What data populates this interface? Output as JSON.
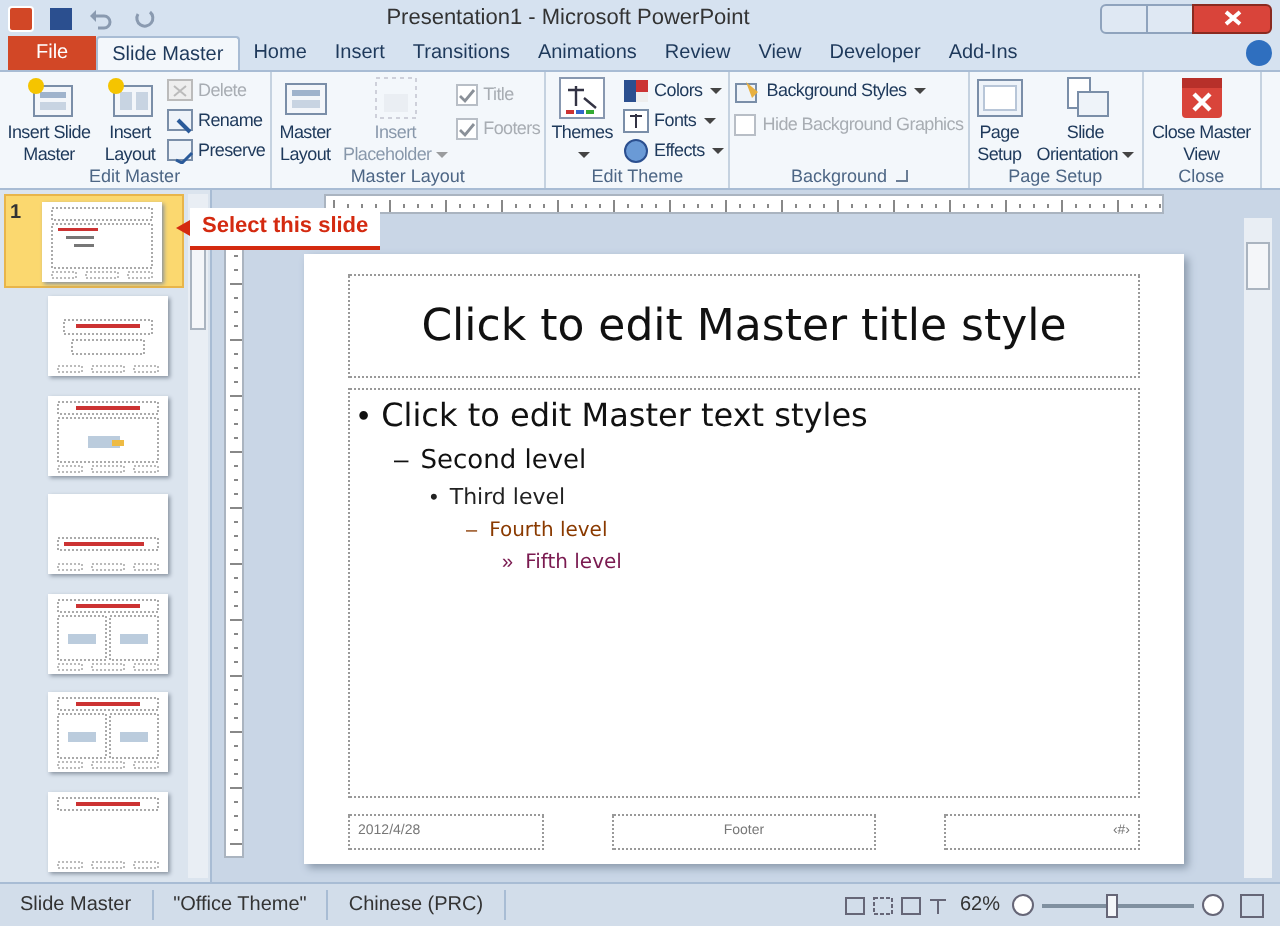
{
  "window": {
    "title": "Presentation1 - Microsoft PowerPoint"
  },
  "tabs": [
    {
      "label": "File",
      "kind": "file",
      "selected": false
    },
    {
      "label": "Slide Master",
      "kind": "tab",
      "selected": true
    },
    {
      "label": "Home",
      "kind": "tab",
      "selected": false
    },
    {
      "label": "Insert",
      "kind": "tab",
      "selected": false
    },
    {
      "label": "Transitions",
      "kind": "tab",
      "selected": false
    },
    {
      "label": "Animations",
      "kind": "tab",
      "selected": false
    },
    {
      "label": "Review",
      "kind": "tab",
      "selected": false
    },
    {
      "label": "View",
      "kind": "tab",
      "selected": false
    },
    {
      "label": "Developer",
      "kind": "tab",
      "selected": false
    },
    {
      "label": "Add-Ins",
      "kind": "tab",
      "selected": false
    }
  ],
  "ribbon": [
    {
      "label": "Edit Master",
      "items": [
        {
          "kind": "large",
          "label": "Insert Slide Master",
          "disabled": false
        },
        {
          "kind": "large",
          "label": "Insert Layout",
          "disabled": false
        },
        {
          "kind": "stack",
          "items": [
            {
              "kind": "small",
              "label": "Delete",
              "disabled": true
            },
            {
              "kind": "small",
              "label": "Rename",
              "disabled": false
            },
            {
              "kind": "small",
              "label": "Preserve",
              "disabled": false
            }
          ]
        }
      ]
    },
    {
      "label": "Master Layout",
      "items": [
        {
          "kind": "large",
          "label": "Master Layout",
          "disabled": false
        },
        {
          "kind": "large",
          "label": "Insert Placeholder",
          "dropdown": true,
          "disabled": true
        },
        {
          "kind": "stack",
          "items": [
            {
              "kind": "check",
              "label": "Title",
              "checked": true,
              "disabled": true
            },
            {
              "kind": "check",
              "label": "Footers",
              "checked": true,
              "disabled": true
            }
          ]
        }
      ]
    },
    {
      "label": "Edit Theme",
      "items": [
        {
          "kind": "large",
          "label": "Themes",
          "dropdown": true,
          "disabled": false
        },
        {
          "kind": "stack",
          "items": [
            {
              "kind": "small",
              "label": "Colors",
              "dropdown": true,
              "disabled": false
            },
            {
              "kind": "small",
              "label": "Fonts",
              "dropdown": true,
              "disabled": false
            },
            {
              "kind": "small",
              "label": "Effects",
              "dropdown": true,
              "disabled": false
            }
          ]
        }
      ]
    },
    {
      "label": "Background",
      "launcher": true,
      "items": [
        {
          "kind": "stack",
          "items": [
            {
              "kind": "small",
              "label": "Background Styles",
              "dropdown": true,
              "disabled": false
            },
            {
              "kind": "check",
              "label": "Hide Background Graphics",
              "checked": false,
              "disabled": true
            }
          ]
        }
      ]
    },
    {
      "label": "Page Setup",
      "items": [
        {
          "kind": "large",
          "label": "Page Setup",
          "disabled": false
        },
        {
          "kind": "large",
          "label": "Slide Orientation",
          "dropdown": true,
          "disabled": false
        }
      ]
    },
    {
      "label": "Close",
      "items": [
        {
          "kind": "large",
          "label": "Close Master View",
          "disabled": false
        }
      ]
    }
  ],
  "slides_panel": {
    "thumbnails": [
      {
        "number": "1",
        "kind": "master",
        "selected": true
      },
      {
        "kind": "title",
        "selected": false
      },
      {
        "kind": "content",
        "selected": false
      },
      {
        "kind": "section",
        "selected": false
      },
      {
        "kind": "two",
        "selected": false
      },
      {
        "kind": "two",
        "selected": false
      },
      {
        "kind": "titleonly",
        "selected": false
      }
    ]
  },
  "callout": {
    "text": "Select this slide"
  },
  "slide": {
    "title": "Click to edit Master title style",
    "body": [
      {
        "bullet": "•",
        "text": "Click to edit Master text styles",
        "children": [
          {
            "bullet": "–",
            "text": "Second level",
            "children": [
              {
                "bullet": "•",
                "text": "Third level",
                "children": [
                  {
                    "bullet": "–",
                    "text": "Fourth level",
                    "children": [
                      {
                        "bullet": "»",
                        "text": "Fifth level"
                      }
                    ]
                  }
                ]
              }
            ]
          }
        ]
      }
    ],
    "footers": [
      "2012/4/28",
      "Footer",
      "‹#›"
    ]
  },
  "status_bar": {
    "items": [
      "Slide Master",
      "\"Office Theme\"",
      "Chinese (PRC)"
    ],
    "zoom": "62%",
    "zoom_slider": {
      "level": 0.45
    }
  }
}
